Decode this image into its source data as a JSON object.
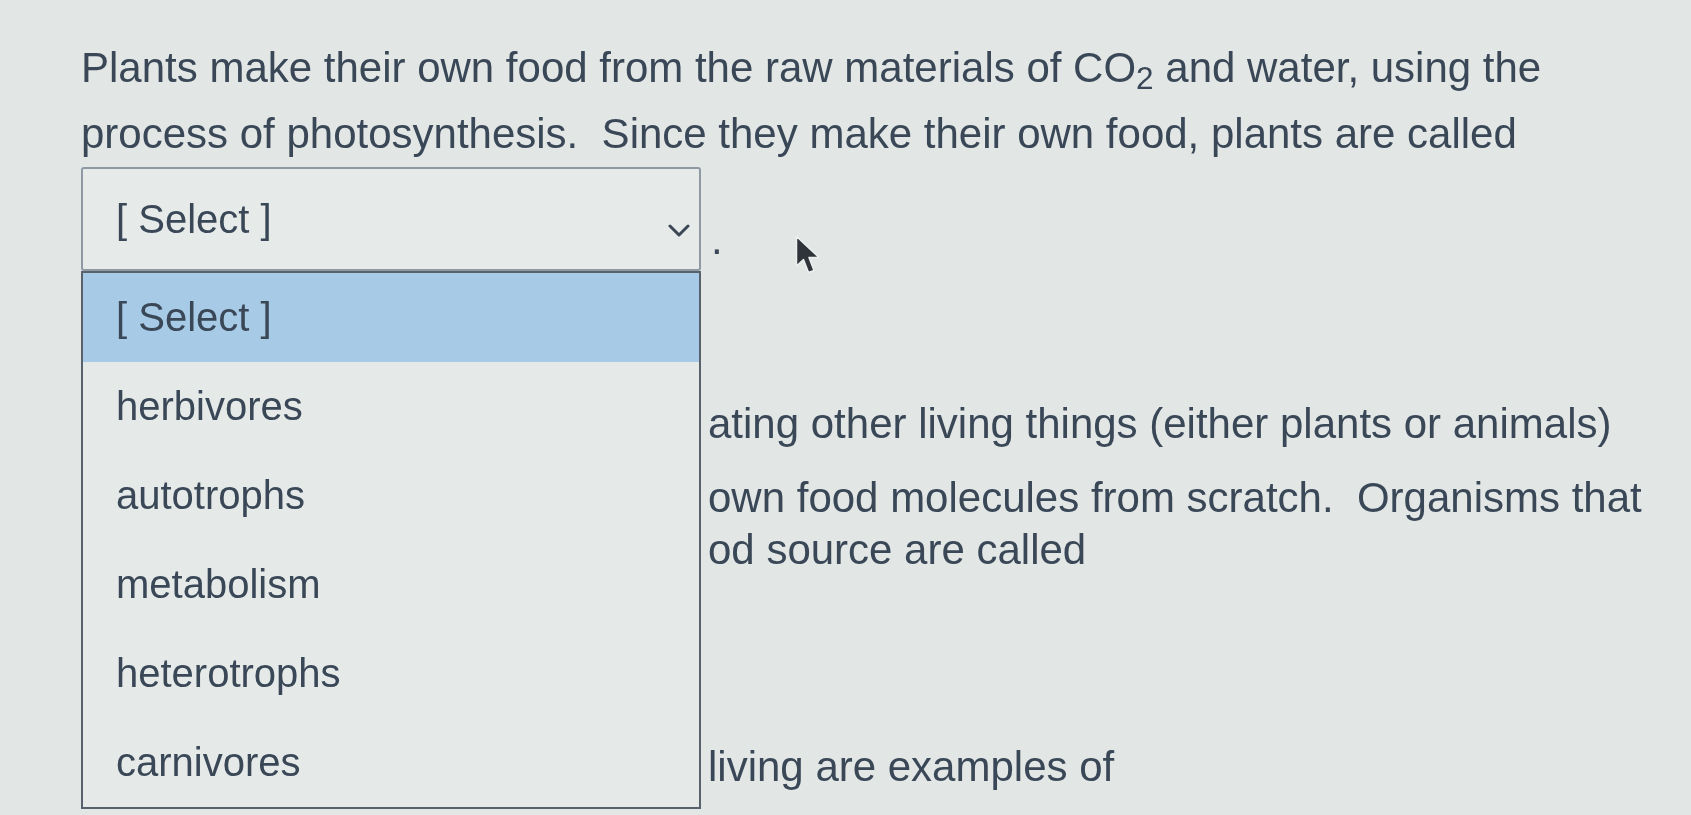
{
  "question": {
    "text": "Plants make their own food from the raw materials of CO$_{2}$ and water, using the process of photosynthesis.  Since they make their own food, plants are called",
    "dropdown": {
      "value": "[ Select ]",
      "expanded": true,
      "options": [
        {
          "label": "[ Select ]",
          "selected": true
        },
        {
          "label": "herbivores",
          "selected": false
        },
        {
          "label": "autotrophs",
          "selected": false
        },
        {
          "label": "metabolism",
          "selected": false
        },
        {
          "label": "heterotrophs",
          "selected": false
        },
        {
          "label": "carnivores",
          "selected": false
        }
      ]
    },
    "after_dropdown": "."
  },
  "covered_text": [
    "ating other living things (either plants or animals)",
    "own food molecules from scratch.  Organisms that",
    "od source are called",
    "living are examples of"
  ]
}
